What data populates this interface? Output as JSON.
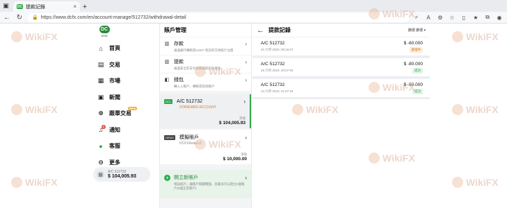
{
  "browser": {
    "tab_title": "提款記錄",
    "url": "https://www.dcfx.com/en/account-manage/512732/withdrawal-detail"
  },
  "sidebar": {
    "logo": "DC",
    "logo_sub": "ASIA",
    "items": [
      {
        "label": "首頁",
        "icon": "home-icon"
      },
      {
        "label": "交易",
        "icon": "chart-icon"
      },
      {
        "label": "市場",
        "icon": "market-icon"
      },
      {
        "label": "新聞",
        "icon": "news-icon"
      },
      {
        "label": "跟單交易",
        "icon": "copy-trade-icon"
      },
      {
        "label": "通知",
        "icon": "bell-icon"
      },
      {
        "label": "客服",
        "icon": "chat-icon"
      },
      {
        "label": "更多",
        "icon": "more-icon"
      }
    ],
    "new_badge": "New",
    "notify_count": "3",
    "account": {
      "label": "A/C 512732",
      "balance": "$ 104,005.93"
    }
  },
  "mid": {
    "title": "賬戶管理",
    "actions": [
      {
        "name": "存款",
        "desc": "通過銀行轉賬或USDT 等您的交易賬戶注資"
      },
      {
        "name": "提款",
        "desc": "通過安全的支付系統提取您的資金"
      },
      {
        "name": "錢包",
        "desc": "轉入入帳戶，轉帳或其他帳戶"
      }
    ],
    "accounts": [
      {
        "tag": "DCL",
        "name": "A/C 512732",
        "type": "STANDARD ACCOUNT",
        "bal_label": "淨值",
        "balance": "$ 104,005.93"
      },
      {
        "tag": "DEMO",
        "name": "模擬賬戶",
        "type": "DCFXAsiaLLC",
        "bal_label": "淨值",
        "balance": "$ 10,000.00"
      }
    ],
    "open": {
      "name": "開立新賬戶",
      "desc": "增設賬戶，讓帳戶開闢實盤、您最多可以開立6個帳戶(5個正常帳戶)"
    }
  },
  "main": {
    "title": "提款記錄",
    "filter": "篩選 篩選 ▾",
    "rows": [
      {
        "account": "A/C 512732",
        "date": "23 六月 2023, 00:16:37",
        "amount": "$ -60.000",
        "status": "處理中",
        "status_kind": "pending"
      },
      {
        "account": "A/C 512732",
        "date": "15 六月 2023, 20:57:03",
        "amount": "$ -80.000",
        "status": "成功",
        "status_kind": "done"
      },
      {
        "account": "A/C 512732",
        "date": "14 六月 2023, 21:07:24",
        "amount": "$ -50.000",
        "status": "成功",
        "status_kind": "done"
      }
    ]
  },
  "watermark": "WikiFX"
}
